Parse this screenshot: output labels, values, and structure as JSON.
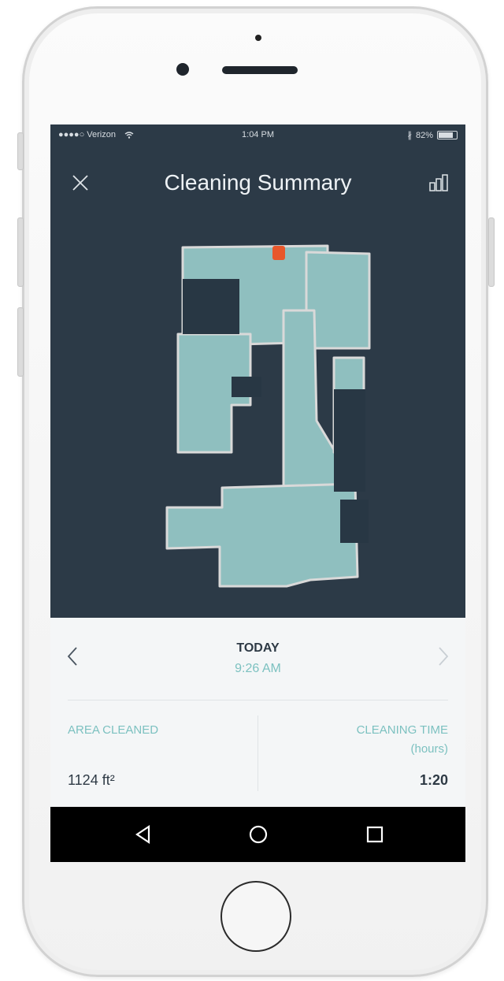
{
  "status_bar": {
    "carrier": "●●●●○ Verizon",
    "wifi_icon": "wifi-icon",
    "time": "1:04 PM",
    "battery": "82%",
    "battery_level": 0.82
  },
  "header": {
    "title": "Cleaning Summary",
    "close_icon": "close-icon",
    "stats_icon": "bar-chart-icon"
  },
  "map": {
    "floor_color": "#8fbfbf",
    "obstacle_color": "#2c3a47",
    "robot_color": "#e8572b"
  },
  "summary": {
    "date_label": "TODAY",
    "date_time": "9:26 AM",
    "area_label": "AREA CLEANED",
    "area_value": "1124 ft²",
    "time_label": "CLEANING TIME",
    "time_unit": "(hours)",
    "time_value": "1:20"
  },
  "colors": {
    "accent": "#7cc1c0",
    "screen_bg": "#2c3a47",
    "panel_bg": "#f4f6f7"
  }
}
